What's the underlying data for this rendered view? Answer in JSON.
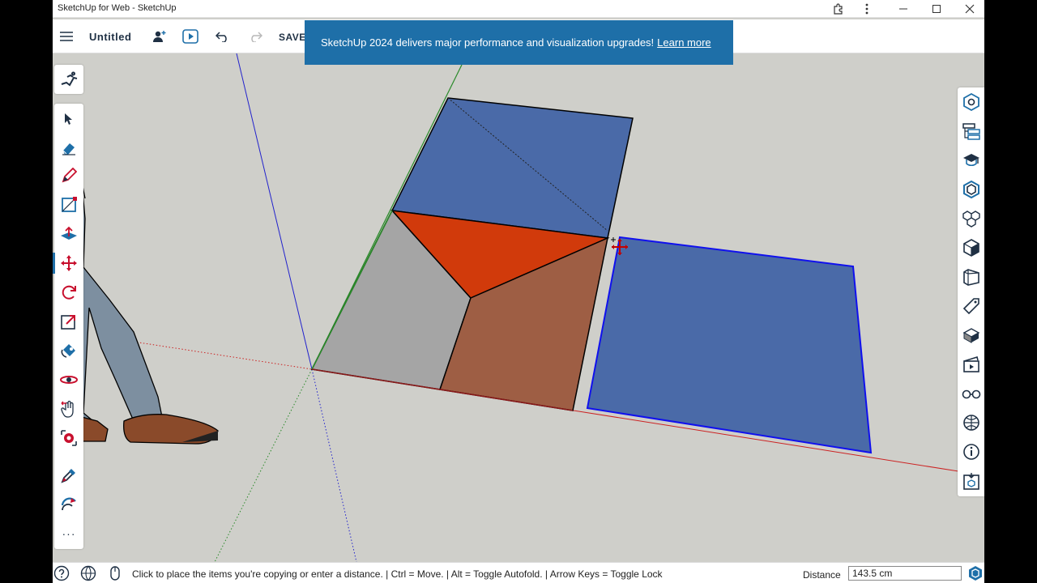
{
  "window": {
    "title": "SketchUp for Web - SketchUp"
  },
  "appbar": {
    "document_title": "Untitled",
    "save_label": "SAVE"
  },
  "banner": {
    "message": "SketchUp 2024 delivers major performance and visualization upgrades!",
    "link_text": "Learn more"
  },
  "toolbox": {
    "active_tool": "move-tool",
    "more_label": "···"
  },
  "statusbar": {
    "hint": "Click to place the items you're copying or enter a distance. | Ctrl = Move. | Alt = Toggle Autofold. | Arrow Keys = Toggle Lock",
    "measurement_label": "Distance",
    "measurement_value": "143.5 cm"
  },
  "scene": {
    "colors": {
      "background": "#cfcfca",
      "face_blue": "#4a6aa8",
      "face_red": "#d13a0b",
      "face_grey": "#a5a5a5",
      "face_brown": "#9e5e44",
      "axis_red": "#cc2222",
      "axis_green": "#2a8a2a",
      "axis_blue": "#2222cc",
      "selection_blue": "#1010ee"
    }
  }
}
